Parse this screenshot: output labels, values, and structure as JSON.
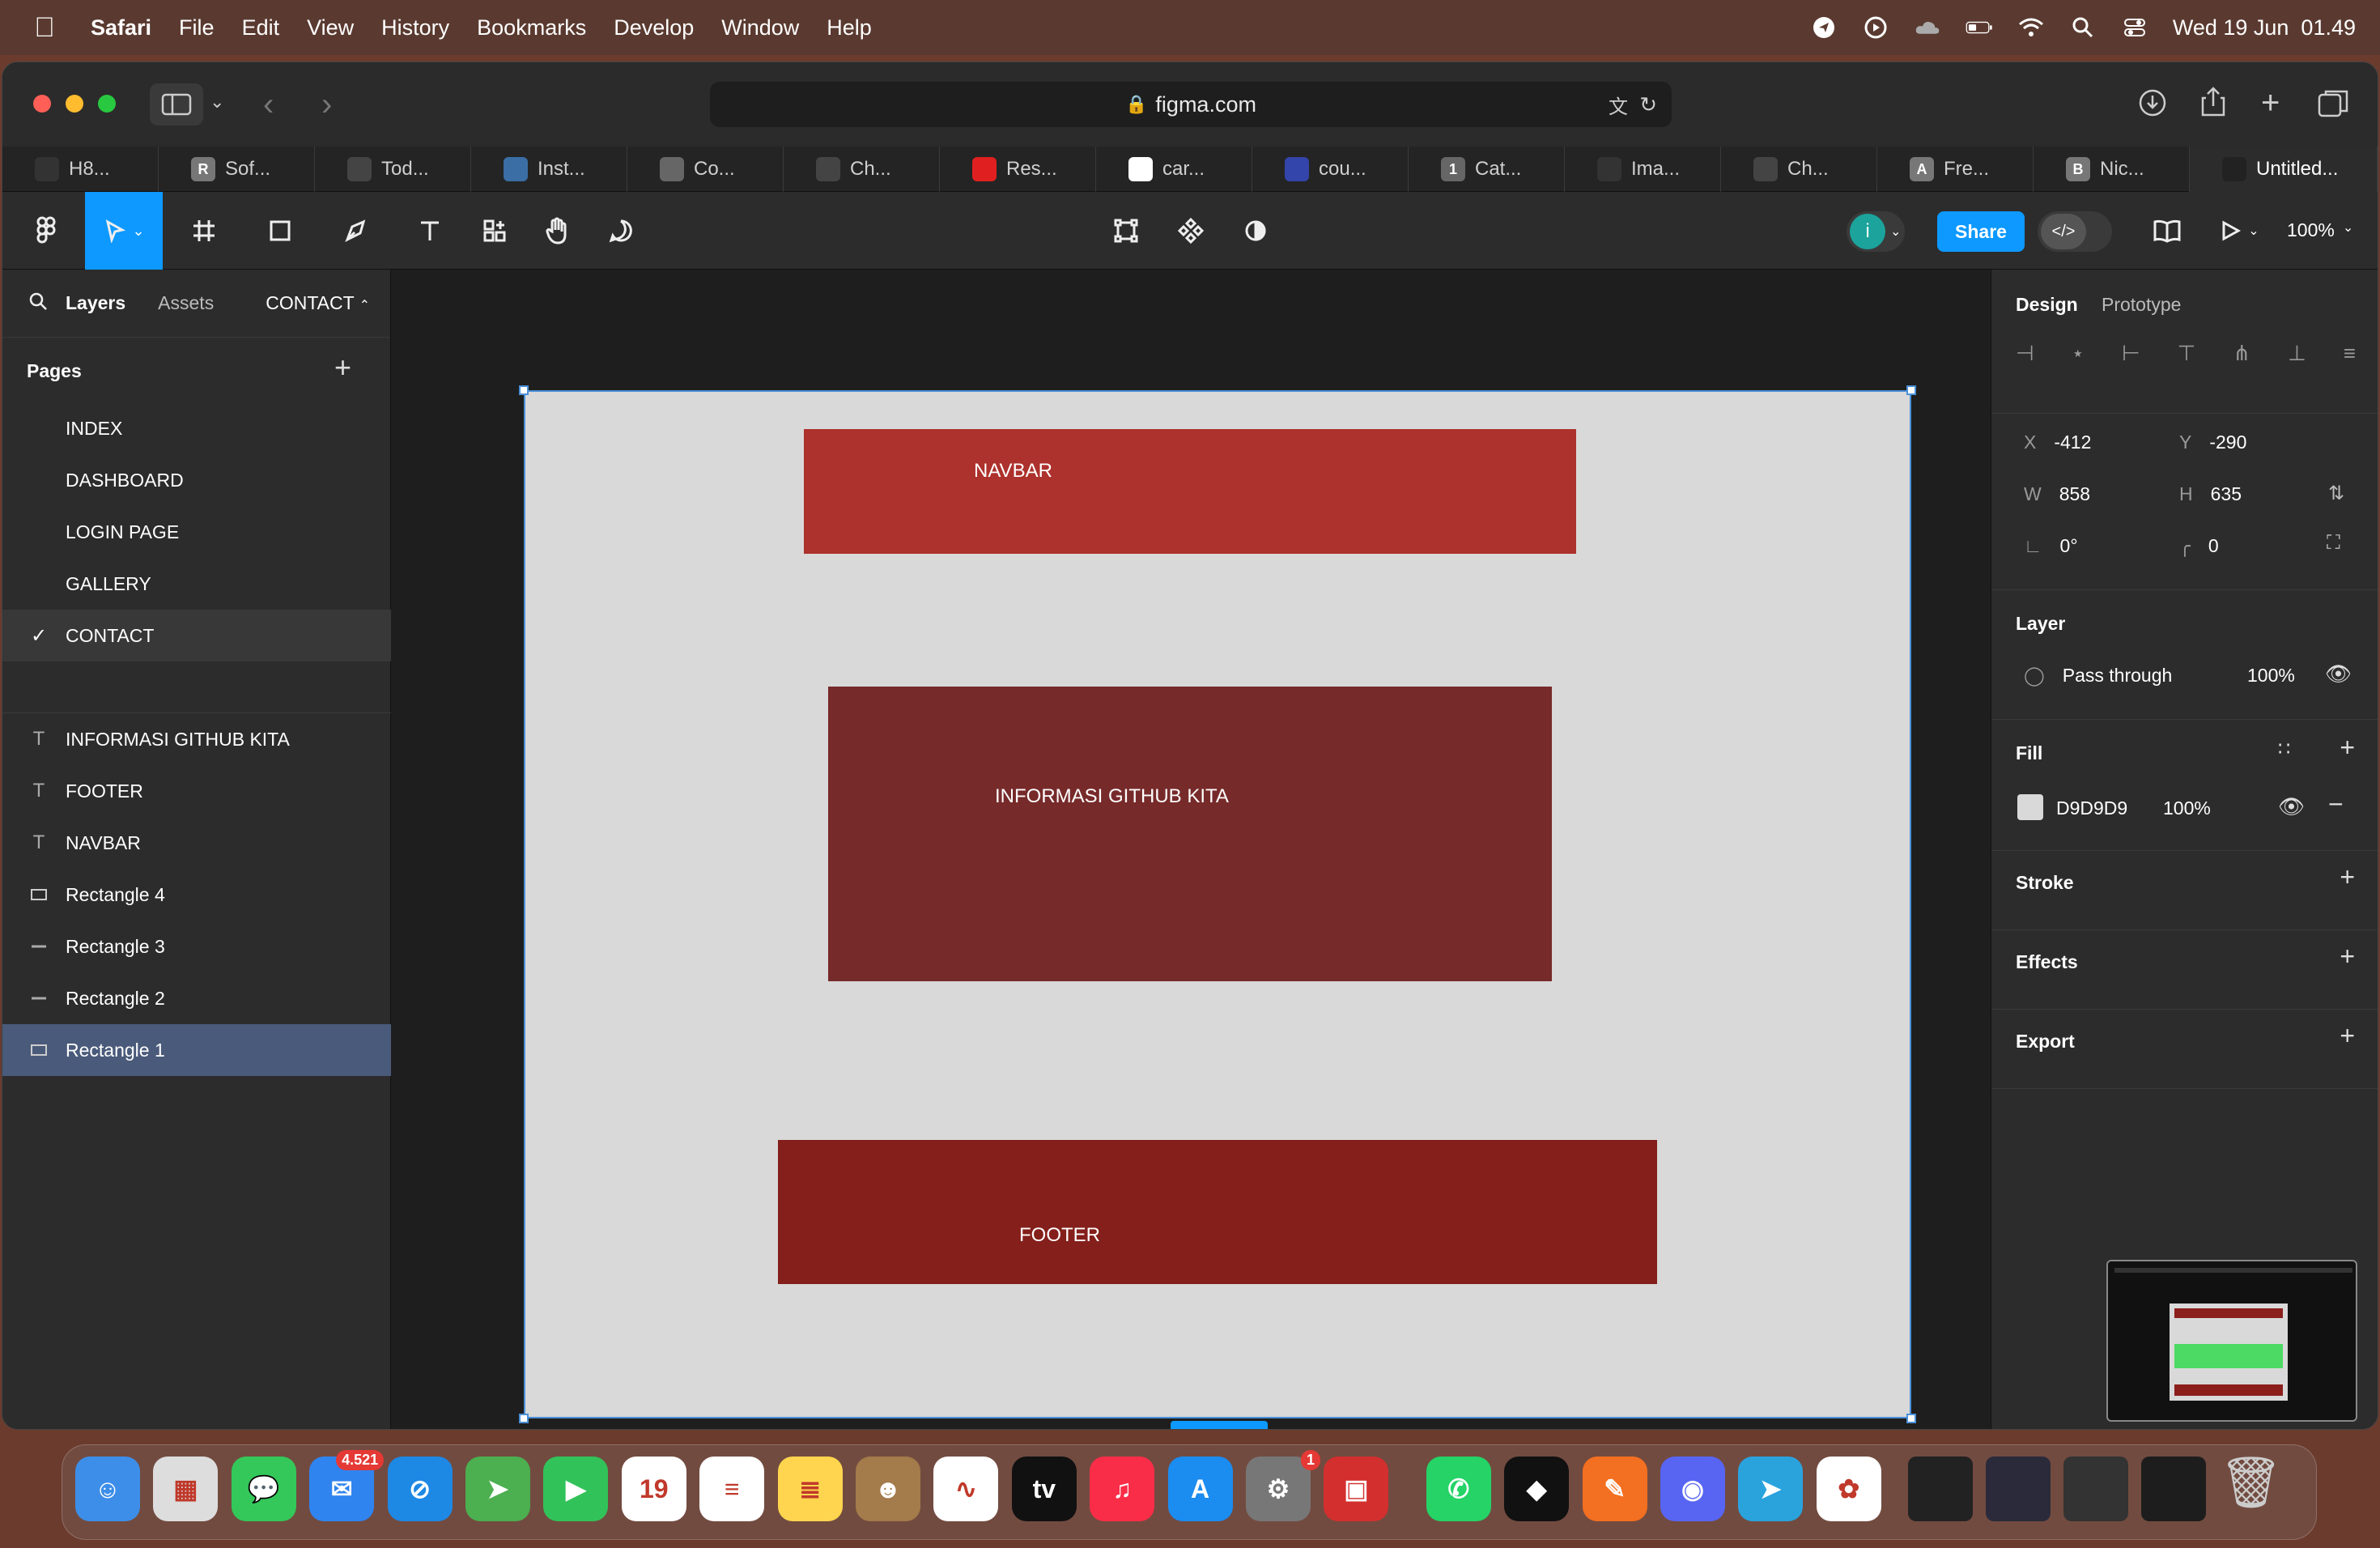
{
  "menubar": {
    "app": "Safari",
    "items": [
      "File",
      "Edit",
      "View",
      "History",
      "Bookmarks",
      "Develop",
      "Window",
      "Help"
    ],
    "clock": "Wed 19 Jun  01.49"
  },
  "browser": {
    "url": "figma.com",
    "tabs": [
      {
        "label": "H8...",
        "icon": "github-icon",
        "color": "#333"
      },
      {
        "label": "Sof...",
        "icon": "letter-r-icon",
        "letter": "R",
        "color": "#777"
      },
      {
        "label": "Tod...",
        "icon": "openai-icon",
        "color": "#444"
      },
      {
        "label": "Inst...",
        "icon": "wave-icon",
        "color": "#3a6ea5"
      },
      {
        "label": "Co...",
        "icon": "copilot-icon",
        "color": "#666"
      },
      {
        "label": "Ch...",
        "icon": "openai-icon",
        "color": "#444"
      },
      {
        "label": "Res...",
        "icon": "youtube-icon",
        "color": "#e02020"
      },
      {
        "label": "car...",
        "icon": "google-icon",
        "color": "#fff"
      },
      {
        "label": "cou...",
        "icon": "bank-icon",
        "color": "#3344aa"
      },
      {
        "label": "Cat...",
        "icon": "number-1-icon",
        "letter": "1",
        "color": "#666"
      },
      {
        "label": "Ima...",
        "icon": "github-icon",
        "color": "#333"
      },
      {
        "label": "Ch...",
        "icon": "openai-icon",
        "color": "#444"
      },
      {
        "label": "Fre...",
        "icon": "letter-a-icon",
        "letter": "A",
        "color": "#777"
      },
      {
        "label": "Nic...",
        "icon": "letter-b-icon",
        "letter": "B",
        "color": "#777"
      },
      {
        "label": "Untitled...",
        "icon": "figma-icon",
        "color": "#222"
      }
    ]
  },
  "figma_toolbar": {
    "avatar_letter": "i",
    "share_label": "Share",
    "zoom": "100%"
  },
  "left_panel": {
    "tabs": {
      "layers": "Layers",
      "assets": "Assets",
      "page_switch": "CONTACT"
    },
    "pages_title": "Pages",
    "pages": [
      "INDEX",
      "DASHBOARD",
      "LOGIN PAGE",
      "GALLERY",
      "CONTACT"
    ],
    "layers": [
      {
        "name": "INFORMASI GITHUB KITA",
        "type": "text"
      },
      {
        "name": "FOOTER",
        "type": "text"
      },
      {
        "name": "NAVBAR",
        "type": "text"
      },
      {
        "name": "Rectangle 4",
        "type": "rect"
      },
      {
        "name": "Rectangle 3",
        "type": "line"
      },
      {
        "name": "Rectangle 2",
        "type": "line"
      },
      {
        "name": "Rectangle 1",
        "type": "rect"
      }
    ]
  },
  "canvas": {
    "navbar_text": "NAVBAR",
    "info_text": "INFORMASI GITHUB KITA",
    "footer_text": "FOOTER",
    "colors": {
      "frame": "#D9D9D9",
      "navbar": "#AD312C",
      "info": "#772A2A",
      "footer": "#841F1B"
    }
  },
  "right_panel": {
    "tabs": {
      "design": "Design",
      "prototype": "Prototype"
    },
    "x": {
      "k": "X",
      "v": "-412"
    },
    "y": {
      "k": "Y",
      "v": "-290"
    },
    "w": {
      "k": "W",
      "v": "858"
    },
    "h": {
      "k": "H",
      "v": "635"
    },
    "rotation": "0°",
    "radius": "0",
    "layer_title": "Layer",
    "blend": "Pass through",
    "opacity": "100%",
    "fill_title": "Fill",
    "fill_hex": "D9D9D9",
    "fill_opacity": "100%",
    "stroke_title": "Stroke",
    "effects_title": "Effects",
    "export_title": "Export"
  },
  "dock": {
    "apps": [
      {
        "name": "finder",
        "color": "#3d8ee8",
        "glyph": "☺"
      },
      {
        "name": "launchpad",
        "color": "#ddd",
        "glyph": "▦"
      },
      {
        "name": "messages",
        "color": "#34c759",
        "glyph": "💬"
      },
      {
        "name": "mail",
        "color": "#2f84f0",
        "glyph": "✉",
        "badge": "4.521"
      },
      {
        "name": "safari",
        "color": "#1e88e5",
        "glyph": "⊘"
      },
      {
        "name": "maps",
        "color": "#4caf50",
        "glyph": "➤"
      },
      {
        "name": "facetime",
        "color": "#32c25a",
        "glyph": "▶"
      },
      {
        "name": "calendar",
        "color": "#fff",
        "glyph": "19"
      },
      {
        "name": "reminders",
        "color": "#fff",
        "glyph": "≡"
      },
      {
        "name": "notes",
        "color": "#ffd54f",
        "glyph": "≣"
      },
      {
        "name": "contacts",
        "color": "#a47b4a",
        "glyph": "☻"
      },
      {
        "name": "freeform",
        "color": "#fff",
        "glyph": "∿"
      },
      {
        "name": "apple-tv",
        "color": "#111",
        "glyph": "tv"
      },
      {
        "name": "music",
        "color": "#fa2d48",
        "glyph": "♫"
      },
      {
        "name": "app-store",
        "color": "#1b8cf0",
        "glyph": "A"
      },
      {
        "name": "system-settings",
        "color": "#777",
        "glyph": "⚙",
        "badge": "1"
      },
      {
        "name": "kahoot",
        "color": "#d32f2f",
        "glyph": "▣"
      },
      {
        "name": "whatsapp",
        "color": "#25d366",
        "glyph": "✆"
      },
      {
        "name": "unity",
        "color": "#111",
        "glyph": "◆"
      },
      {
        "name": "pencil",
        "color": "#f36f21",
        "glyph": "✎"
      },
      {
        "name": "discord",
        "color": "#5865f2",
        "glyph": "◉"
      },
      {
        "name": "telegram",
        "color": "#2aa3dd",
        "glyph": "➤"
      },
      {
        "name": "photos",
        "color": "#fff",
        "glyph": "✿"
      }
    ]
  }
}
